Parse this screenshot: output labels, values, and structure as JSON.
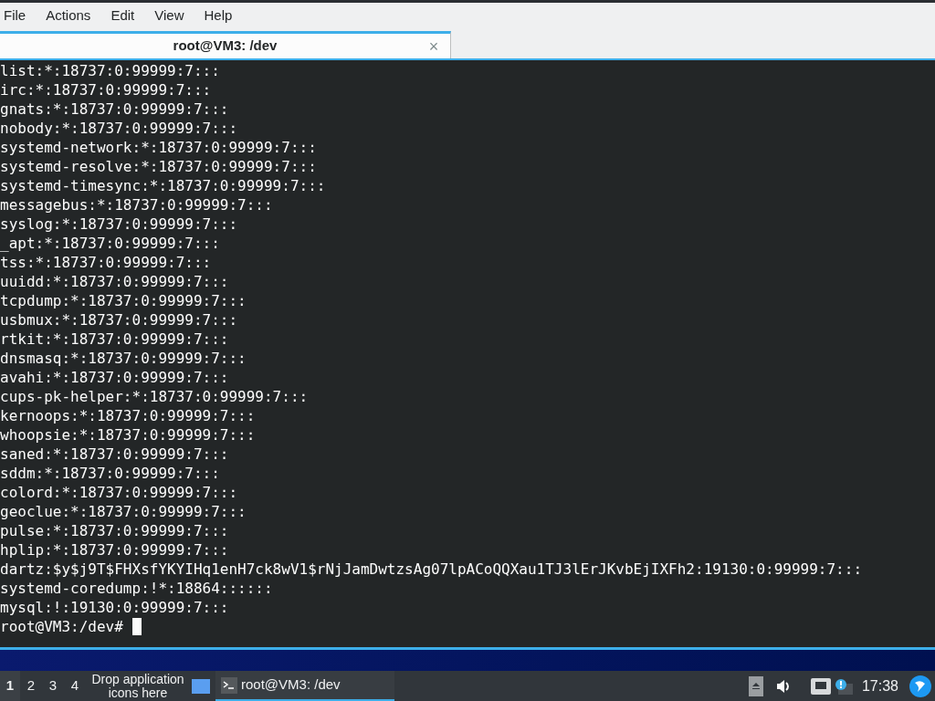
{
  "menu": [
    "File",
    "Actions",
    "Edit",
    "View",
    "Help"
  ],
  "tab": {
    "title": "root@VM3: /dev",
    "close": "×"
  },
  "terminal": {
    "lines": [
      "list:*:18737:0:99999:7:::",
      "irc:*:18737:0:99999:7:::",
      "gnats:*:18737:0:99999:7:::",
      "nobody:*:18737:0:99999:7:::",
      "systemd-network:*:18737:0:99999:7:::",
      "systemd-resolve:*:18737:0:99999:7:::",
      "systemd-timesync:*:18737:0:99999:7:::",
      "messagebus:*:18737:0:99999:7:::",
      "syslog:*:18737:0:99999:7:::",
      "_apt:*:18737:0:99999:7:::",
      "tss:*:18737:0:99999:7:::",
      "uuidd:*:18737:0:99999:7:::",
      "tcpdump:*:18737:0:99999:7:::",
      "usbmux:*:18737:0:99999:7:::",
      "rtkit:*:18737:0:99999:7:::",
      "dnsmasq:*:18737:0:99999:7:::",
      "avahi:*:18737:0:99999:7:::",
      "cups-pk-helper:*:18737:0:99999:7:::",
      "kernoops:*:18737:0:99999:7:::",
      "whoopsie:*:18737:0:99999:7:::",
      "saned:*:18737:0:99999:7:::",
      "sddm:*:18737:0:99999:7:::",
      "colord:*:18737:0:99999:7:::",
      "geoclue:*:18737:0:99999:7:::",
      "pulse:*:18737:0:99999:7:::",
      "hplip:*:18737:0:99999:7:::",
      "dartz:$y$j9T$FHXsfYKYIHq1enH7ck8wV1$rNjJamDwtzsAg07lpACoQQXau1TJ3lErJKvbEjIXFh2:19130:0:99999:7:::",
      "systemd-coredump:!*:18864::::::",
      "mysql:!:19130:0:99999:7:::"
    ],
    "prompt": "root@VM3:/dev#"
  },
  "taskbar": {
    "desktops": [
      {
        "label": "1",
        "selected": true
      },
      {
        "label": "2",
        "selected": false
      },
      {
        "label": "3",
        "selected": false
      },
      {
        "label": "4",
        "selected": false
      }
    ],
    "drop_hint": "Drop application icons here",
    "task": {
      "title": "root@VM3: /dev"
    },
    "clock": "17:38"
  }
}
